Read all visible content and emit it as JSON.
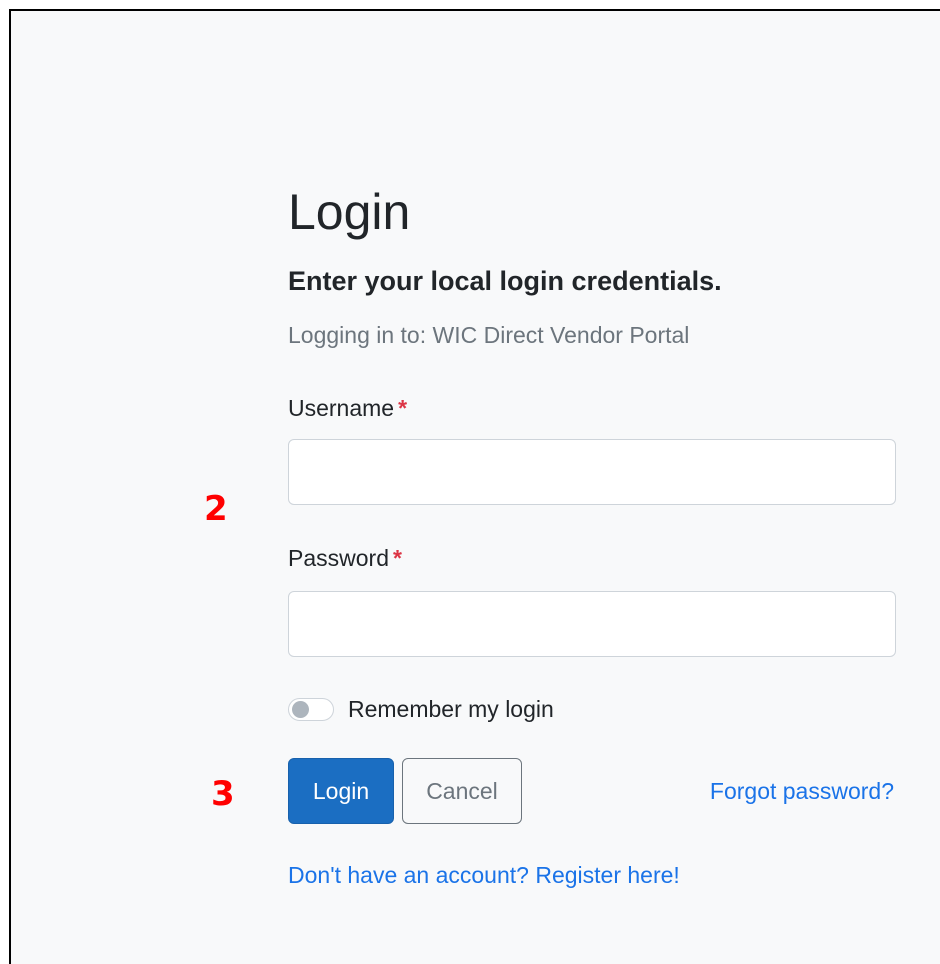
{
  "heading": {
    "title": "Login",
    "subtitle": "Enter your local login credentials.",
    "context": "Logging in to: WIC Direct Vendor Portal"
  },
  "form": {
    "username": {
      "label": "Username",
      "required_mark": "*",
      "value": ""
    },
    "password": {
      "label": "Password",
      "required_mark": "*",
      "value": ""
    },
    "remember": {
      "label": "Remember my login",
      "checked": false
    }
  },
  "actions": {
    "login_label": "Login",
    "cancel_label": "Cancel",
    "forgot_label": "Forgot password?",
    "register_label": "Don't have an account? Register here!"
  },
  "annotations": {
    "marker_fields": "2",
    "marker_buttons": "3"
  },
  "colors": {
    "primary": "#1b6ec2",
    "link": "#1a73e8",
    "required": "#dc3545",
    "annotation": "#ff0000",
    "page_background": "#f8f9fa"
  }
}
